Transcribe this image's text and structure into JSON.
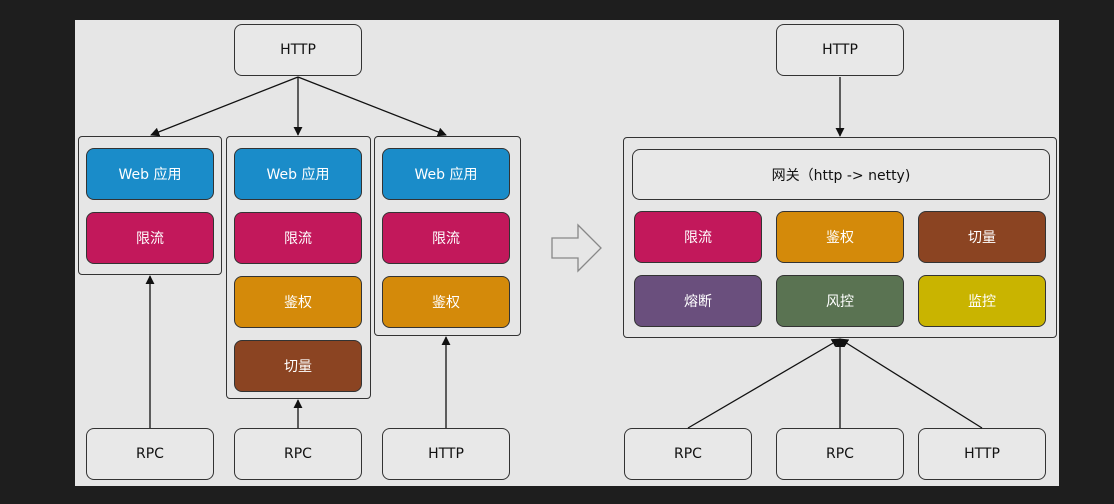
{
  "left": {
    "top_http": "HTTP",
    "groups": [
      {
        "items": [
          "Web 应用",
          "限流"
        ]
      },
      {
        "items": [
          "Web 应用",
          "限流",
          "鉴权",
          "切量"
        ]
      },
      {
        "items": [
          "Web 应用",
          "限流",
          "鉴权"
        ]
      }
    ],
    "bottom": [
      "RPC",
      "RPC",
      "HTTP"
    ]
  },
  "right": {
    "top_http": "HTTP",
    "gateway": "网关（http -> netty)",
    "modules": [
      "限流",
      "鉴权",
      "切量",
      "熔断",
      "风控",
      "监控"
    ],
    "bottom": [
      "RPC",
      "RPC",
      "HTTP"
    ]
  },
  "colors": {
    "web": "#1a8cc9",
    "limit": "#c2185b",
    "auth": "#d48a0a",
    "cut": "#8b4422",
    "fuse": "#6a4f7d",
    "risk": "#5a7352",
    "monitor": "#c9b400"
  }
}
